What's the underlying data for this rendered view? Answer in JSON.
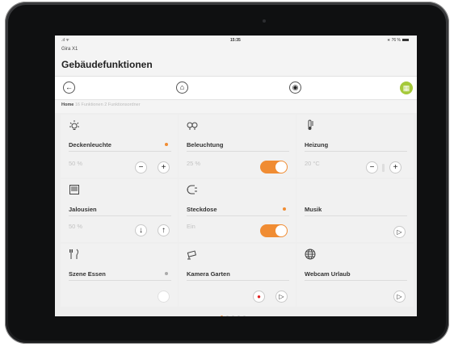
{
  "status": {
    "signal": ".ıl  ᯤ",
    "time": "15:35",
    "battery": "∗ 76 %"
  },
  "app": {
    "name": "Gira X1",
    "title": "Gebäudefunktionen"
  },
  "nav": {
    "back": "←",
    "home": "⌂",
    "scene": "◉",
    "grid": "▦"
  },
  "breadcrumb": {
    "home": "Home",
    "info": "16 Funktionen 2 Funktionsordner"
  },
  "tiles": [
    {
      "label": "Deckenleuchte",
      "value": "50 %",
      "minus": "−",
      "plus": "+"
    },
    {
      "label": "Beleuchtung",
      "value": "25 %"
    },
    {
      "label": "Heizung",
      "value": "20 °C",
      "minus": "−",
      "plus": "+"
    },
    {
      "label": "Jalousien",
      "value": "50 %",
      "down": "↓",
      "up": "↑"
    },
    {
      "label": "Steckdose",
      "value": "Ein"
    },
    {
      "label": "Musik",
      "play": "▷"
    },
    {
      "label": "Szene Essen",
      "btn": ""
    },
    {
      "label": "Kamera Garten",
      "rec": "●",
      "play": "▷"
    },
    {
      "label": "Webcam Urlaub",
      "play": "▷"
    }
  ],
  "icons": {
    "lamp": "lamp-icon",
    "double-lamp": "double-lamp-icon",
    "thermometer": "thermometer-icon",
    "blinds": "blinds-icon",
    "socket": "socket-icon",
    "cutlery": "cutlery-icon",
    "camera": "camera-icon",
    "globe": "globe-icon"
  },
  "colors": {
    "accent": "#f08c33",
    "grid_button": "#a5c93a",
    "record": "#e02020"
  },
  "pager": {
    "count": 5,
    "active": 0
  }
}
